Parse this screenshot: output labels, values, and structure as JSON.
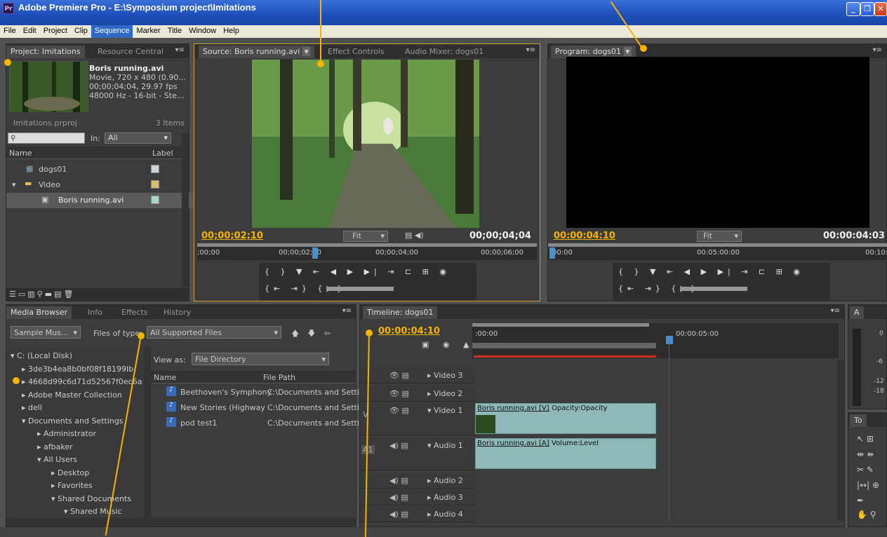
{
  "window": {
    "title": "Adobe Premiere Pro - E:\\Symposium project\\Imitations",
    "app_icon": "Pr"
  },
  "menu": [
    "File",
    "Edit",
    "Project",
    "Clip",
    "Sequence",
    "Marker",
    "Title",
    "Window",
    "Help"
  ],
  "menu_highlight": "Sequence",
  "project": {
    "tabs": [
      "Project: Imitations",
      "Resource Central"
    ],
    "clip_name": "Boris running.avi",
    "clip_info": [
      "Movie, 720 x 480 (0.90...",
      "00;00;04;04, 29.97 fps",
      "48000 Hz - 16-bit - Ste..."
    ],
    "project_file": "Imitations.prproj",
    "item_count": "3 Items",
    "in_label": "In:",
    "in_value": "All",
    "col_name": "Name",
    "col_label": "Label",
    "items": [
      {
        "name": "dogs01",
        "color": "#c8d4d8"
      },
      {
        "name": "Video",
        "color": "#d8bc70"
      },
      {
        "name": "Boris running.avi",
        "color": "#a8d8c8"
      }
    ]
  },
  "source": {
    "tabs": [
      "Source: Boris running.avi",
      "Effect Controls",
      "Audio Mixer: dogs01"
    ],
    "timecode": "00;00;02;10",
    "fit": "Fit",
    "duration": "00;00;04;04",
    "ruler": [
      ";00;00",
      "00;00;02;00",
      "00;00;04;00",
      "00;00;06;00"
    ]
  },
  "program": {
    "tab": "Program: dogs01",
    "timecode": "00:00:04:10",
    "fit": "Fit",
    "duration": "00:00:04:03",
    "ruler": [
      "00:00",
      "00:05:00:00",
      "00:10:"
    ]
  },
  "media": {
    "tabs": [
      "Media Browser",
      "Info",
      "Effects",
      "History"
    ],
    "source_dropdown": "Sample Mus...",
    "files_of_type_label": "Files of type:",
    "files_of_type": "All Supported Files",
    "view_as_label": "View as:",
    "view_as": "File Directory",
    "col_name": "Name",
    "col_path": "File Path",
    "tree": [
      "C: (Local Disk)",
      "3de3b4ea8b0bf08f18199Ib",
      "4668d99c6d71d52567f0ec6a",
      "Adobe Master Collection",
      "dell",
      "Documents and Settings",
      "Administrator",
      "afbaker",
      "All Users",
      "Desktop",
      "Favorites",
      "Shared Documents",
      "Shared Music"
    ],
    "files": [
      {
        "name": "Beethoven's Symphony",
        "path": "C:\\Documents and Settin"
      },
      {
        "name": "New Stories (Highway",
        "path": "C:\\Documents and Settin"
      },
      {
        "name": "pod test1",
        "path": "C:\\Documents and Settin"
      }
    ]
  },
  "timeline": {
    "tab": "Timeline: dogs01",
    "timecode": "00:00:04:10",
    "ruler": [
      ":00:00",
      "00:00:05:00"
    ],
    "tracks": [
      "Video 3",
      "Video 2",
      "Video 1",
      "Audio 1",
      "Audio 2",
      "Audio 3",
      "Audio 4"
    ],
    "v_label": "V",
    "a1_label": "A1",
    "video_clip": "Boris running.avi [V]",
    "video_fx": "Opacity:Opacity",
    "audio_clip": "Boris running.avi [A]",
    "audio_fx": "Volume:Level"
  },
  "right": {
    "a_tab": "A",
    "tools_tab": "To",
    "meter_labels": [
      "0",
      "-6",
      "-12",
      "-18"
    ]
  },
  "colors": {
    "accent": "#f5b400",
    "clip": "#8fb8b8",
    "playhead": "#d03020"
  }
}
